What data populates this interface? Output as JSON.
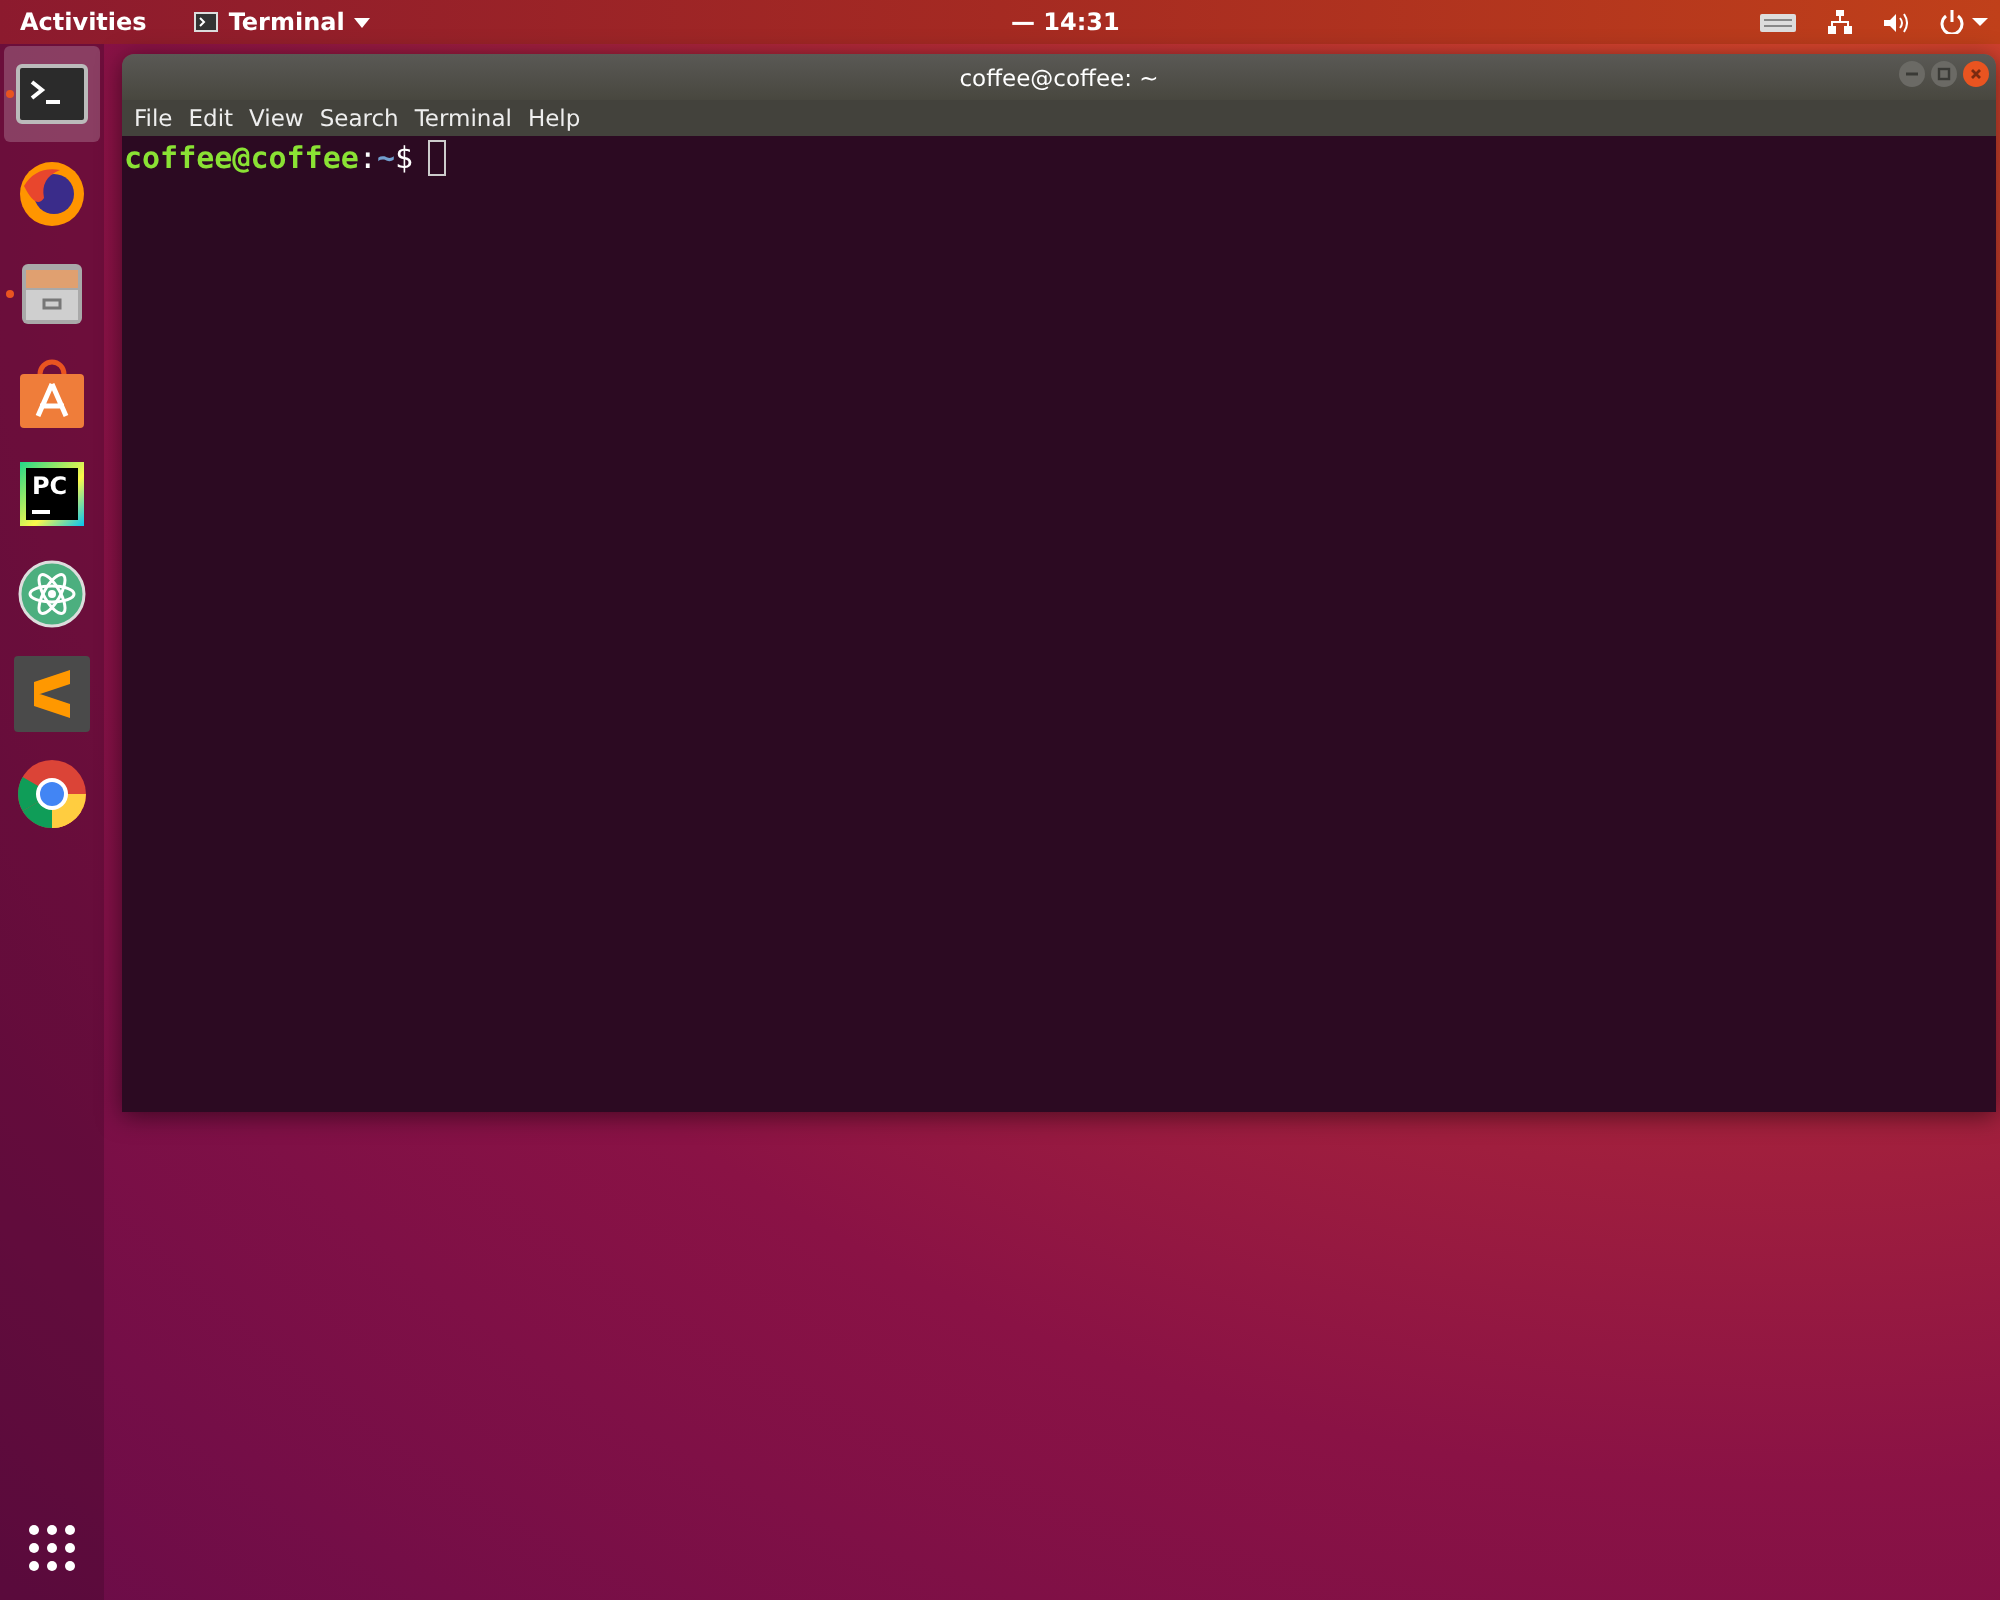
{
  "top_bar": {
    "activities": "Activities",
    "app_menu": "Terminal",
    "clock": "— 14:31"
  },
  "dock": {
    "items": [
      {
        "kind": "terminal",
        "running": true,
        "selected": true
      },
      {
        "kind": "firefox",
        "running": false,
        "selected": false
      },
      {
        "kind": "files",
        "running": true,
        "selected": false
      },
      {
        "kind": "software",
        "running": false,
        "selected": false
      },
      {
        "kind": "pycharm",
        "running": false,
        "selected": false,
        "glyph": "PC"
      },
      {
        "kind": "atom",
        "running": false,
        "selected": false
      },
      {
        "kind": "sublime",
        "running": false,
        "selected": false
      },
      {
        "kind": "chrome",
        "running": false,
        "selected": false
      }
    ]
  },
  "window": {
    "title": "coffee@coffee: ~",
    "menu": [
      "File",
      "Edit",
      "View",
      "Search",
      "Terminal",
      "Help"
    ],
    "prompt": {
      "user_host": "coffee@coffee",
      "separator": ":",
      "path": "~",
      "symbol": "$"
    }
  }
}
